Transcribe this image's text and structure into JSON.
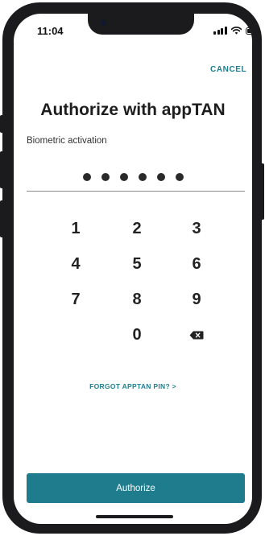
{
  "status_bar": {
    "time": "11:04",
    "icons": [
      "signal-icon",
      "wifi-icon",
      "battery-icon"
    ]
  },
  "header": {
    "cancel_label": "CANCEL"
  },
  "main": {
    "title": "Authorize with appTAN",
    "subtitle": "Biometric activation",
    "pin": {
      "entered_digits": 6
    },
    "keypad": {
      "keys": [
        "1",
        "2",
        "3",
        "4",
        "5",
        "6",
        "7",
        "8",
        "9",
        "0"
      ],
      "backspace_icon": "backspace-icon"
    },
    "forgot_label": "FORGOT APPTAN PIN? >"
  },
  "footer": {
    "authorize_label": "Authorize"
  },
  "colors": {
    "accent": "#1f7c8d",
    "link": "#1f7f92",
    "text": "#1d1d1d"
  }
}
